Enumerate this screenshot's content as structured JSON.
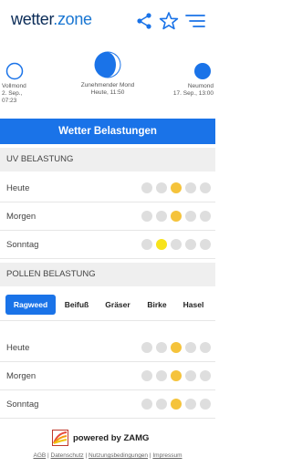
{
  "header": {
    "logo_main": "wetter",
    "logo_dot": ".",
    "logo_zone": "zone",
    "icons": [
      "share-icon",
      "star-icon",
      "menu-icon"
    ]
  },
  "moon_phases": [
    {
      "label": "Vollmond",
      "date": "2. Sep., 07:23"
    },
    {
      "label": "Zunehmender Mond",
      "date": "Heute, 11:50"
    },
    {
      "label": "Neumond",
      "date": "17. Sep., 13:00"
    }
  ],
  "banner": {
    "title": "Wetter Belastungen"
  },
  "uv": {
    "title": "UV BELASTUNG",
    "rows": [
      {
        "label": "Heute",
        "level": 3,
        "color": "#f5c33b"
      },
      {
        "label": "Morgen",
        "level": 3,
        "color": "#f5c33b"
      },
      {
        "label": "Sonntag",
        "level": 2,
        "color": "#f7e31b"
      }
    ]
  },
  "pollen": {
    "title": "POLLEN BELASTUNG",
    "tabs": [
      "Ragweed",
      "Beifuß",
      "Gräser",
      "Birke",
      "Hasel"
    ],
    "active_tab": "Ragweed",
    "rows": [
      {
        "label": "Heute",
        "level": 3,
        "color": "#f5c33b"
      },
      {
        "label": "Morgen",
        "level": 3,
        "color": "#f5c33b"
      },
      {
        "label": "Sonntag",
        "level": 3,
        "color": "#f5c33b"
      }
    ]
  },
  "footer": {
    "powered_by": "powered by",
    "brand": "ZAMG",
    "links": [
      "AGB",
      "Datenschutz",
      "Nutzungsbedingungen",
      "Impressum"
    ],
    "separator": " | "
  },
  "colors": {
    "accent": "#1a73e8",
    "dot_inactive": "#dedede"
  }
}
